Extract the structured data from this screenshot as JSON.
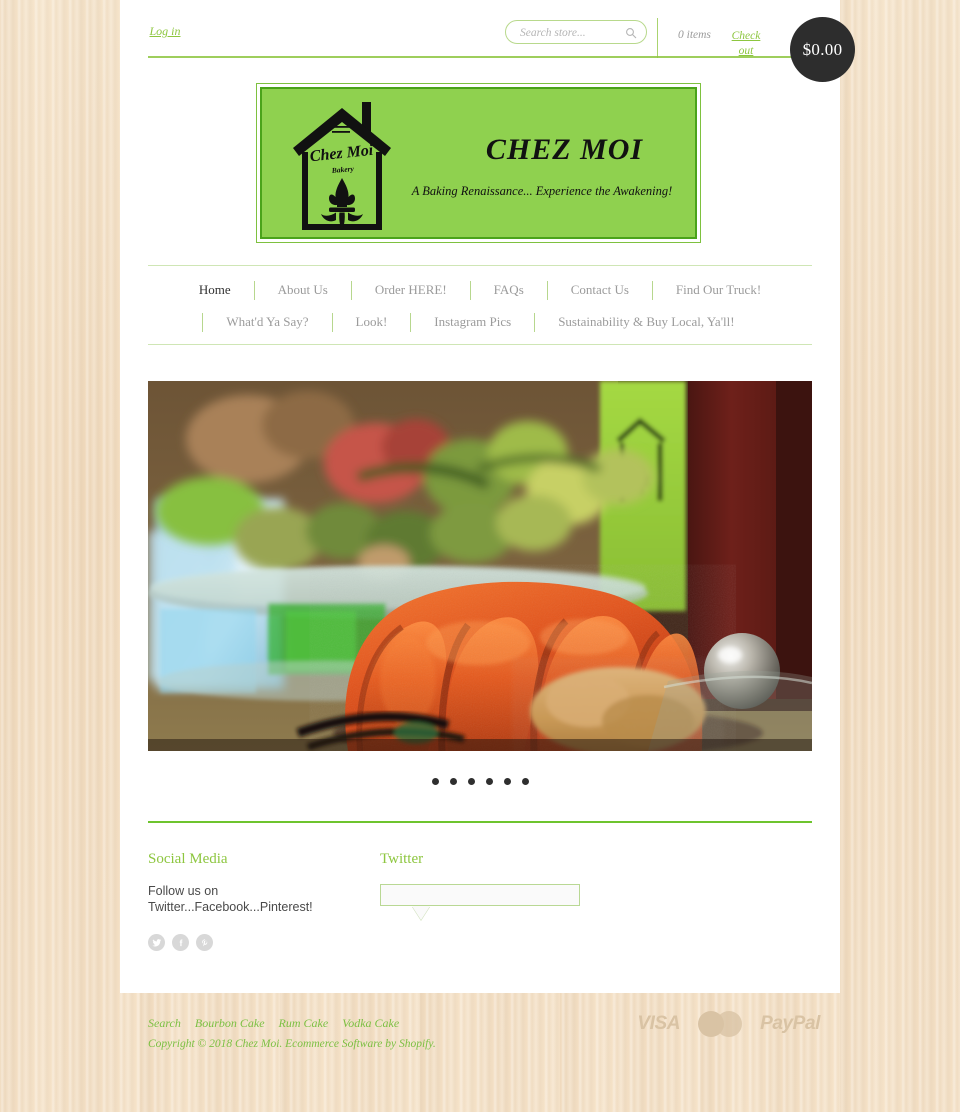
{
  "topbar": {
    "login_label": "Log in",
    "search_placeholder": "Search store...",
    "search_value": "",
    "search_icon": "search-icon",
    "cart_items": "0 items",
    "checkout_label": "Check out",
    "cart_total": "$0.00"
  },
  "logo": {
    "title": "CHEZ MOI",
    "tagline": "A Baking Renaissance... Experience the Awakening!",
    "mark_text": "Chez Moi",
    "mark_subtext": "Bakery",
    "background_color": "#8fd14f",
    "border_color": "#4aa31a"
  },
  "nav": {
    "row1": [
      {
        "label": "Home",
        "active": true
      },
      {
        "label": "About Us",
        "active": false
      },
      {
        "label": "Order HERE!",
        "active": false
      },
      {
        "label": "FAQs",
        "active": false
      },
      {
        "label": "Contact Us",
        "active": false
      },
      {
        "label": "Find Our Truck!",
        "active": false
      }
    ],
    "row2": [
      {
        "label": "What'd Ya Say?",
        "active": false
      },
      {
        "label": "Look!",
        "active": false
      },
      {
        "label": "Instagram Pics",
        "active": false
      },
      {
        "label": "Sustainability & Buy Local, Ya'll!",
        "active": false
      }
    ]
  },
  "hero": {
    "alt": "Glazed orange bundt cake on a glass cake stand with fruit and brown sugar",
    "slide_count": 6,
    "active_slide": 1
  },
  "footer": {
    "social": {
      "heading": "Social Media",
      "text": "Follow us on Twitter...Facebook...Pinterest!",
      "icons": [
        "twitter-icon",
        "facebook-icon",
        "pinterest-icon"
      ]
    },
    "twitter": {
      "heading": "Twitter",
      "tweet_text": ""
    }
  },
  "bottom": {
    "links": [
      "Search",
      "Bourbon Cake",
      "Rum Cake",
      "Vodka Cake"
    ],
    "copyright_prefix": "Copyright © 2018 Chez Moi. Ecommerce Software by ",
    "copyright_link": "Shopify",
    "copyright_suffix": ".",
    "payments": [
      "VISA",
      "Mastercard",
      "PayPal"
    ],
    "visa_label": "VISA",
    "paypal_label": "PayPal"
  },
  "colors": {
    "accent_green": "#8dc63f",
    "rule_green": "#6ec42e",
    "cart_dark": "#2d2d2d",
    "wood_bg": "#f3ddc0"
  }
}
